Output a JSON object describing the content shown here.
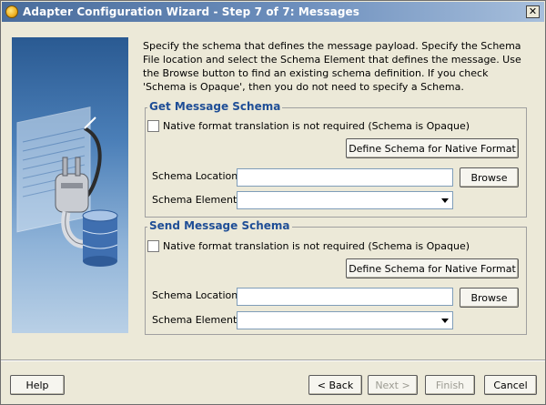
{
  "window": {
    "title": "Adapter Configuration Wizard - Step 7 of 7: Messages",
    "close_glyph": "✕"
  },
  "intro": "Specify the schema that defines the message payload.  Specify the Schema File location and select the Schema Element that defines the message. Use the Browse button to find an existing schema definition. If you check 'Schema is Opaque', then you do not need to specify a Schema.",
  "get_schema": {
    "legend": "Get Message Schema",
    "opaque_label": "Native format translation is not required (Schema is Opaque)",
    "opaque_checked": false,
    "define_button": "Define Schema for Native Format",
    "location_label": "Schema Location:",
    "location_value": "",
    "browse_button": "Browse",
    "element_label": "Schema Element:",
    "element_value": ""
  },
  "send_schema": {
    "legend": "Send Message Schema",
    "opaque_label": "Native format translation is not required (Schema is Opaque)",
    "opaque_checked": false,
    "define_button": "Define Schema for Native Format",
    "location_label": "Schema Location:",
    "location_value": "",
    "browse_button": "Browse",
    "element_label": "Schema Element:",
    "element_value": ""
  },
  "footer": {
    "help": "Help",
    "back": "< Back",
    "next": "Next >",
    "finish": "Finish",
    "cancel": "Cancel",
    "next_enabled": false,
    "finish_enabled": false
  }
}
